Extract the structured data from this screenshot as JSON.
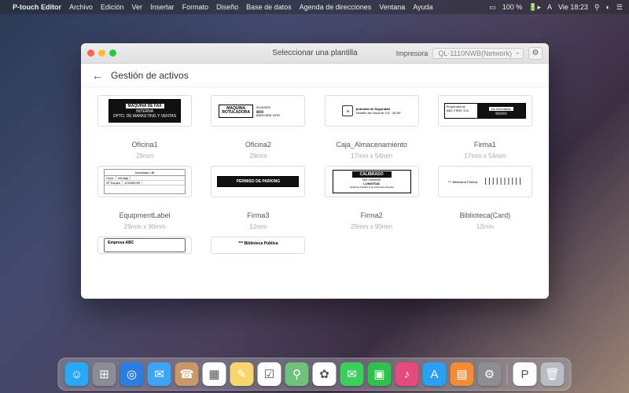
{
  "menubar": {
    "app": "P-touch Editor",
    "items": [
      "Archivo",
      "Edición",
      "Ver",
      "Insertar",
      "Formato",
      "Diseño",
      "Base de datos",
      "Agenda de direcciones",
      "Ventana",
      "Ayuda"
    ],
    "battery": "100 %",
    "clock": "Vie 18:23"
  },
  "window": {
    "title": "Seleccionar una plantilla",
    "printer_label": "Impresora",
    "printer_value": "QL-1110NWB(Network)",
    "heading": "Gestión de activos"
  },
  "templates": [
    {
      "name": "Oficina1",
      "size": "29mm"
    },
    {
      "name": "Oficina2",
      "size": "29mm"
    },
    {
      "name": "Caja_Almacenamiento",
      "size": "17mm x 54mm"
    },
    {
      "name": "Firma1",
      "size": "17mm x 54mm"
    },
    {
      "name": "EquipmentLabel",
      "size": "29mm x 90mm"
    },
    {
      "name": "Firma3",
      "size": "12mm"
    },
    {
      "name": "Firma2",
      "size": "29mm x 90mm"
    },
    {
      "name": "Biblioteca(Card)",
      "size": "12mm"
    },
    {
      "name": "",
      "size": ""
    },
    {
      "name": "",
      "size": ""
    }
  ],
  "thumb_text": {
    "fax": "MÁQUINA DE FAX",
    "fax_sub1": "INTERNA",
    "fax_sub2": "DPTO. DE MARKETING Y VENTAS",
    "rot1": "MAQUINA",
    "rot2": "ROTULADORA",
    "seg_t": "Arandela de Seguridad",
    "seg_s": "Tamaño de rosca de 1/4\"  .25 NF",
    "park": "PERMISO DE PARKING",
    "cal": "CALIBRADO",
    "cal_sub": "LONGITUD",
    "bib": "Biblioteca Pública",
    "emp": "Empresa ABC",
    "bib2": "*** Biblioteca Pública",
    "ind": "Industrias LBI",
    "noinv": "No Inventariar"
  },
  "dock": [
    {
      "n": "finder",
      "c": "#2aa8f5",
      "t": "☺"
    },
    {
      "n": "launchpad",
      "c": "#8c8c97",
      "t": "⊞"
    },
    {
      "n": "safari",
      "c": "#2a7de1",
      "t": "◎"
    },
    {
      "n": "mail",
      "c": "#3da5f4",
      "t": "✉"
    },
    {
      "n": "contacts",
      "c": "#c9976a",
      "t": "☎"
    },
    {
      "n": "calendar",
      "c": "#ffffff",
      "t": "▦"
    },
    {
      "n": "notes",
      "c": "#f9d66c",
      "t": "✎"
    },
    {
      "n": "reminders",
      "c": "#ffffff",
      "t": "☑"
    },
    {
      "n": "maps",
      "c": "#6fc27b",
      "t": "⚲"
    },
    {
      "n": "photos",
      "c": "#ffffff",
      "t": "✿"
    },
    {
      "n": "messages",
      "c": "#39d15b",
      "t": "✉"
    },
    {
      "n": "facetime",
      "c": "#2fc04e",
      "t": "▣"
    },
    {
      "n": "itunes",
      "c": "#e44a7a",
      "t": "♪"
    },
    {
      "n": "appstore",
      "c": "#2aa0f3",
      "t": "A"
    },
    {
      "n": "books",
      "c": "#f38c34",
      "t": "▤"
    },
    {
      "n": "prefs",
      "c": "#8d8d92",
      "t": "⚙"
    },
    {
      "n": "ptouch",
      "c": "#ffffff",
      "t": "P"
    },
    {
      "n": "trash",
      "c": "#b9bcc2",
      "t": "🗑"
    }
  ]
}
